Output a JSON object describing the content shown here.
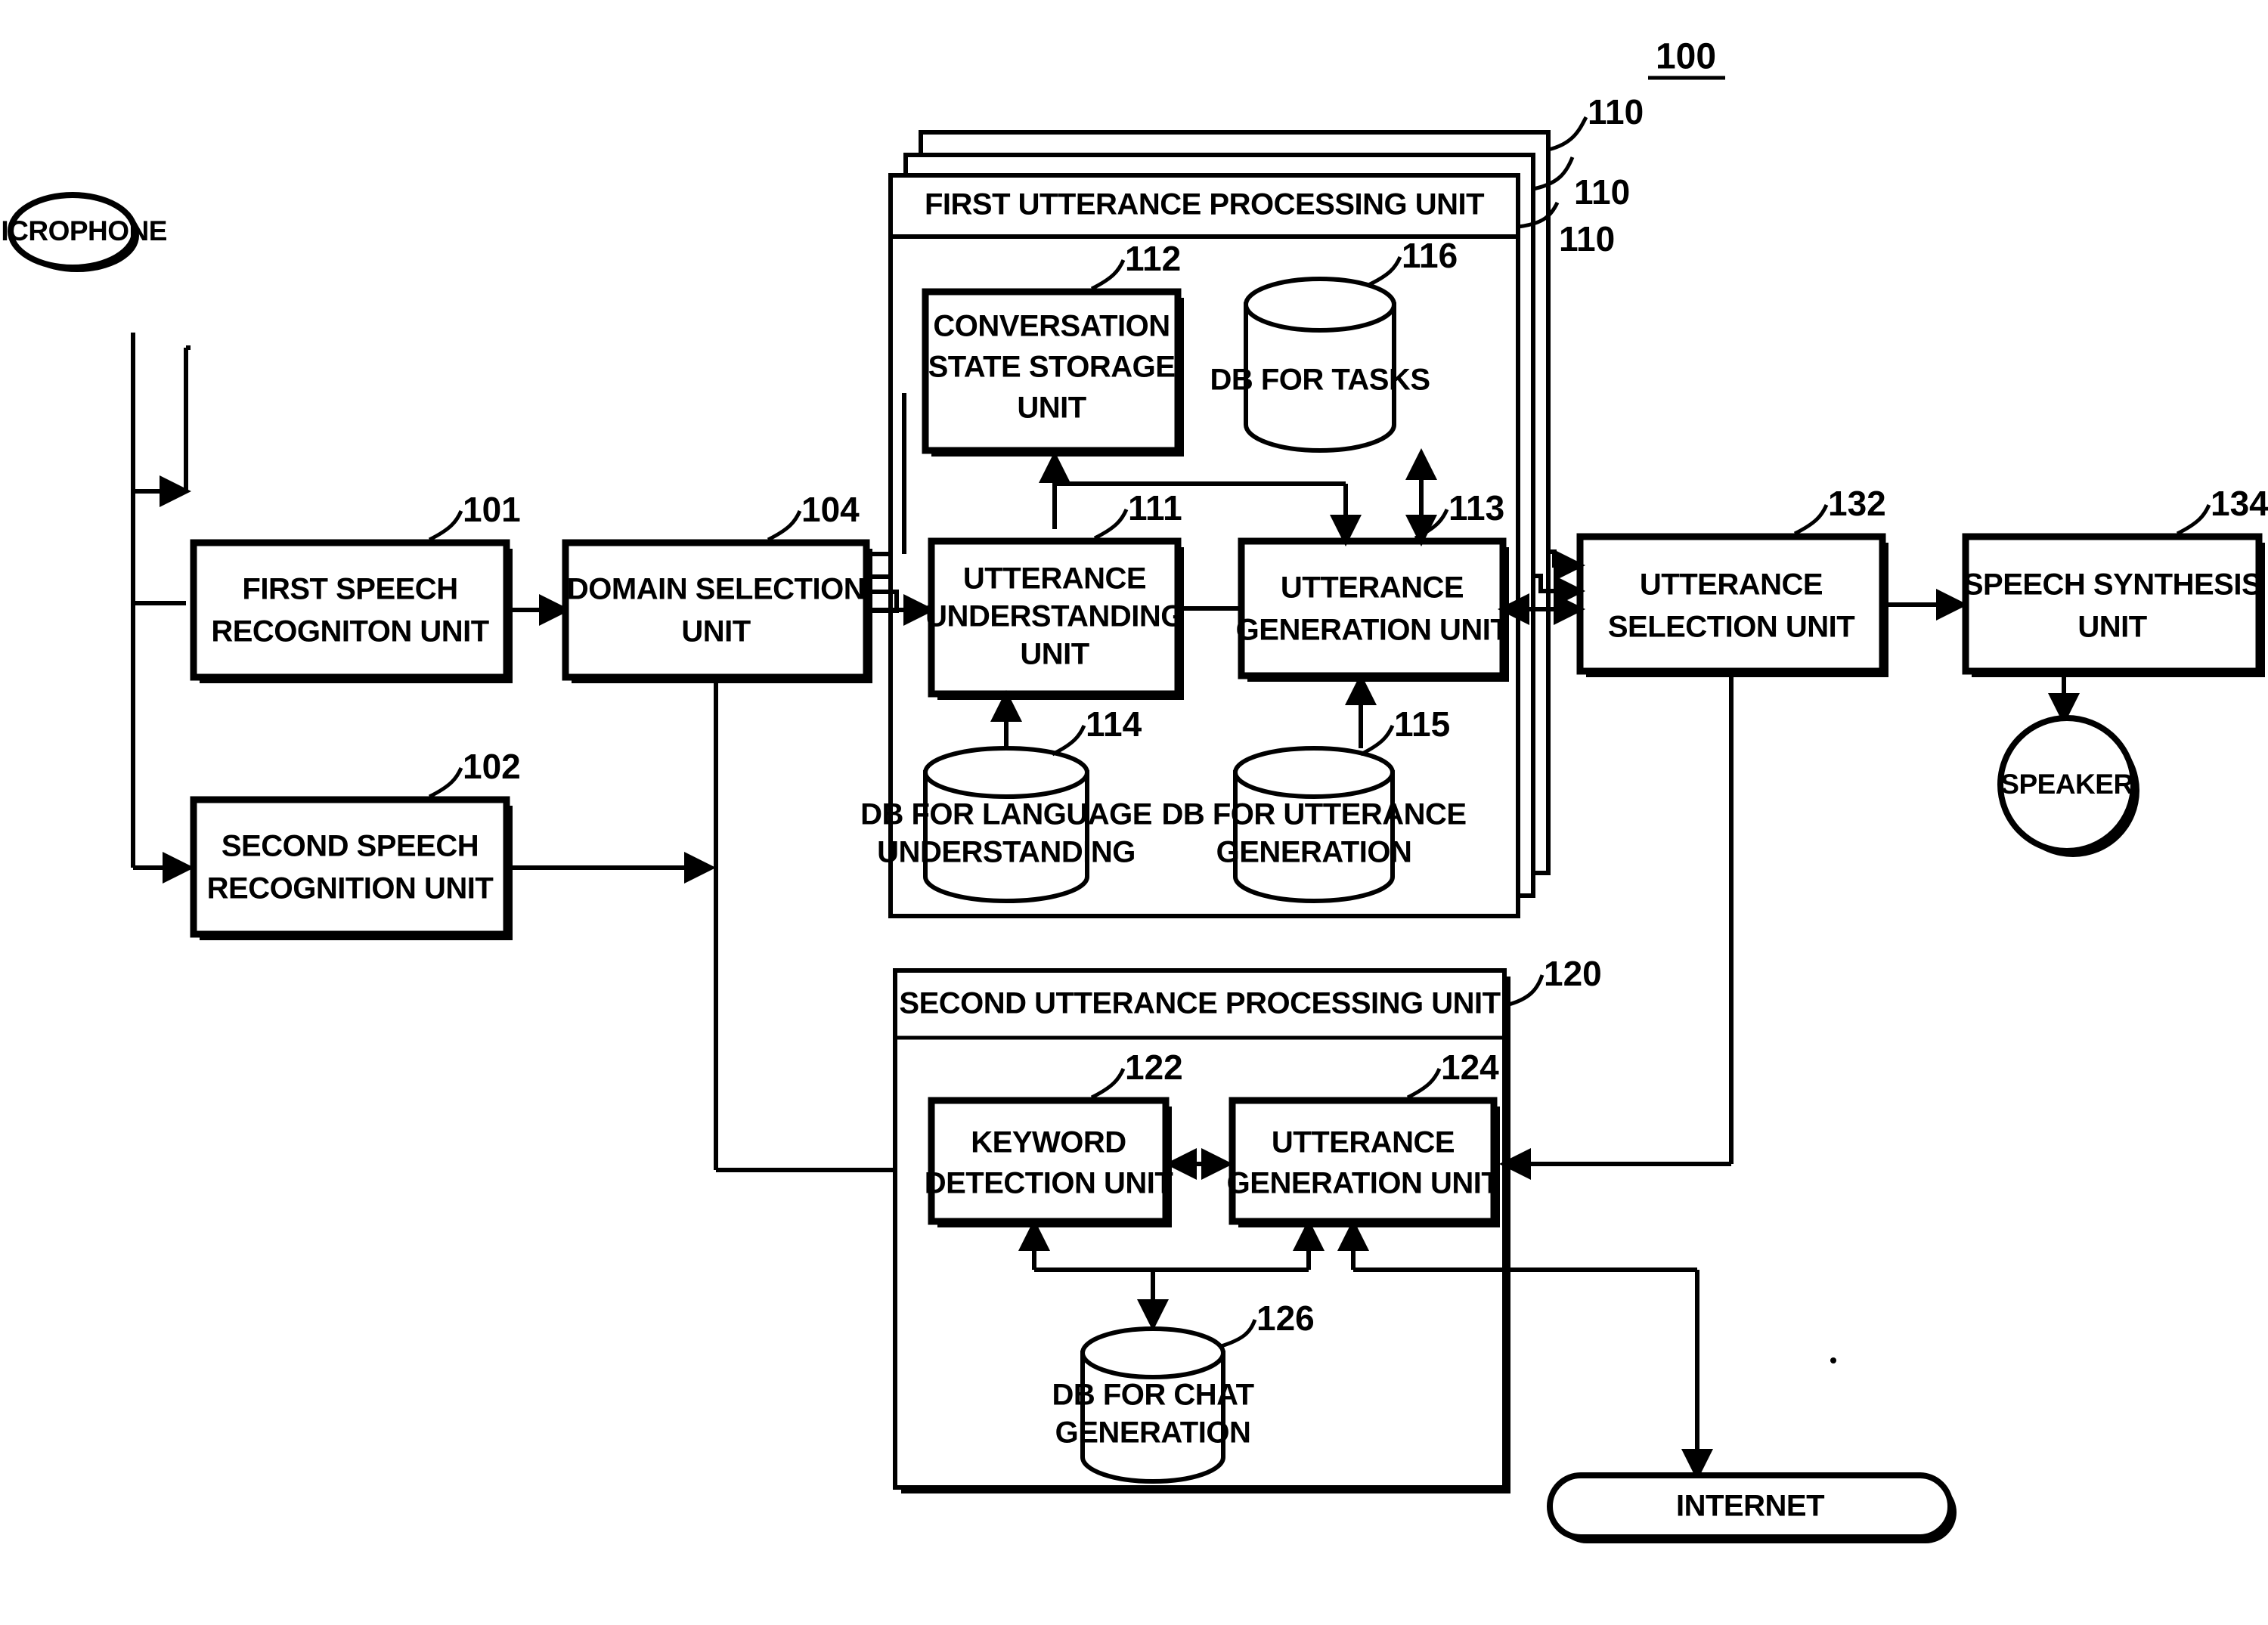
{
  "figure": {
    "system_ref": "100"
  },
  "nodes": {
    "microphone": {
      "label": "MICROPHONE"
    },
    "speaker": {
      "label": "SPEAKER"
    },
    "internet": {
      "label": "INTERNET"
    },
    "first_speech_recognition": {
      "label_line1": "FIRST SPEECH",
      "label_line2": "RECOGNITON UNIT",
      "ref": "101"
    },
    "second_speech_recognition": {
      "label_line1": "SECOND SPEECH",
      "label_line2": "RECOGNITION UNIT",
      "ref": "102"
    },
    "domain_selection": {
      "label_line1": "DOMAIN SELECTION",
      "label_line2": "UNIT",
      "ref": "104"
    },
    "first_utterance_processing": {
      "label": "FIRST UTTERANCE PROCESSING UNIT",
      "ref": "110",
      "ref2": "110",
      "ref3": "110"
    },
    "conversation_state_storage": {
      "label_line1": "CONVERSATION",
      "label_line2": "STATE STORAGE",
      "label_line3": "UNIT",
      "ref": "112"
    },
    "db_for_tasks": {
      "label": "DB FOR TASKS",
      "ref": "116"
    },
    "utterance_understanding": {
      "label_line1": "UTTERANCE",
      "label_line2": "UNDERSTANDING",
      "label_line3": "UNIT",
      "ref": "111"
    },
    "utterance_generation_first": {
      "label_line1": "UTTERANCE",
      "label_line2": "GENERATION UNIT",
      "ref": "113"
    },
    "db_for_language_understanding": {
      "label_line1": "DB FOR LANGUAGE",
      "label_line2": "UNDERSTANDING",
      "ref": "114"
    },
    "db_for_utterance_generation": {
      "label_line1": "DB FOR UTTERANCE",
      "label_line2": "GENERATION",
      "ref": "115"
    },
    "second_utterance_processing": {
      "label": "SECOND UTTERANCE PROCESSING UNIT",
      "ref": "120"
    },
    "keyword_detection": {
      "label_line1": "KEYWORD",
      "label_line2": "DETECTION UNIT",
      "ref": "122"
    },
    "utterance_generation_second": {
      "label_line1": "UTTERANCE",
      "label_line2": "GENERATION UNIT",
      "ref": "124"
    },
    "db_for_chat_generation": {
      "label_line1": "DB FOR CHAT",
      "label_line2": "GENERATION",
      "ref": "126"
    },
    "utterance_selection": {
      "label_line1": "UTTERANCE",
      "label_line2": "SELECTION UNIT",
      "ref": "132"
    },
    "speech_synthesis": {
      "label_line1": "SPEECH SYNTHESIS",
      "label_line2": "UNIT",
      "ref": "134"
    }
  },
  "colors": {
    "ink": "#000000",
    "paper": "#ffffff"
  }
}
